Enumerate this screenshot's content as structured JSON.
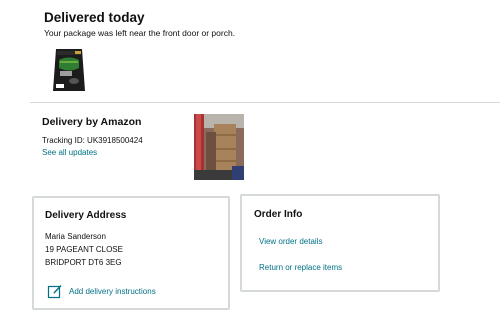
{
  "status": {
    "title": "Delivered today",
    "subtitle": "Your package was left near the front door or porch."
  },
  "product": {
    "image_icon": "pet-food-bag-image"
  },
  "carrier": {
    "title": "Delivery by Amazon",
    "tracking": "Tracking ID: UK3918500424",
    "see_updates": "See all updates",
    "photo_icon": "delivery-proof-photo"
  },
  "address": {
    "title": "Delivery Address",
    "name": "Maria Sanderson",
    "street": "19 PAGEANT CLOSE",
    "city": "BRIDPORT DT6 3EG",
    "instructions_label": "Add delivery instructions",
    "instructions_icon": "edit-note-icon"
  },
  "order": {
    "title": "Order Info",
    "view_details": "View order details",
    "return_replace": "Return or replace items"
  },
  "colors": {
    "link": "#007185",
    "border": "#d5d9d9",
    "text": "#0f1111"
  }
}
